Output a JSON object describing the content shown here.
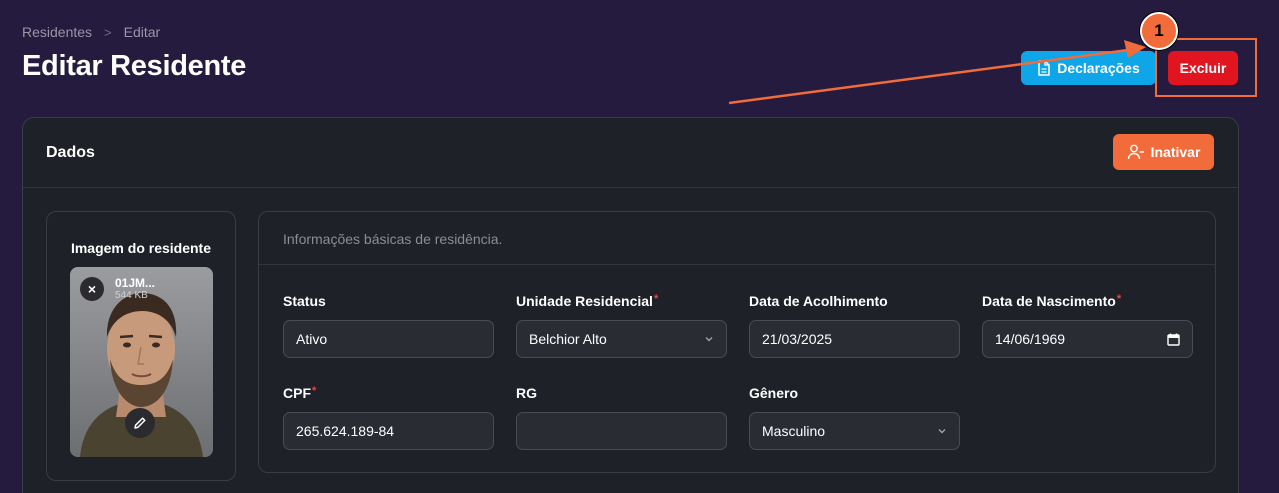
{
  "breadcrumb": {
    "items": [
      "Residentes",
      "Editar"
    ],
    "separator": ">"
  },
  "page_title": "Editar Residente",
  "header_actions": {
    "declaracoes_label": "Declarações",
    "excluir_label": "Excluir"
  },
  "annotation": {
    "marker_label": "1",
    "color": "#f26b3a"
  },
  "card": {
    "title": "Dados",
    "inativar_label": "Inativar"
  },
  "photo": {
    "label": "Imagem do residente",
    "file_name": "01JM...",
    "file_size": "544 KB",
    "remove_glyph": "×"
  },
  "form": {
    "description": "Informações básicas de residência.",
    "fields": {
      "status": {
        "label": "Status",
        "value": "Ativo"
      },
      "unidade": {
        "label": "Unidade Residencial",
        "required": "*",
        "value": "Belchior Alto"
      },
      "acolhimento": {
        "label": "Data de Acolhimento",
        "value": "21/03/2025"
      },
      "nascimento": {
        "label": "Data de Nascimento",
        "required": "*",
        "value": "14/06/1969"
      },
      "cpf": {
        "label": "CPF",
        "required": "*",
        "value": "265.624.189-84"
      },
      "rg": {
        "label": "RG",
        "value": ""
      },
      "genero": {
        "label": "Gênero",
        "value": "Masculino"
      }
    }
  },
  "colors": {
    "background": "#241b3e",
    "info": "#0ea5e9",
    "danger": "#e0151f",
    "warning": "#f26b3a",
    "card": "#1f2128"
  }
}
